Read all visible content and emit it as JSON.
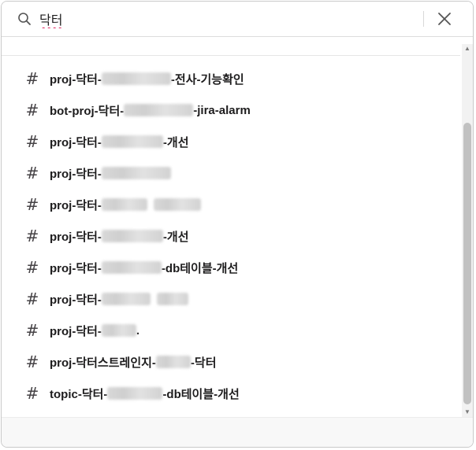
{
  "search": {
    "value": "닥터",
    "search_icon": "search-icon",
    "close_icon": "close-icon"
  },
  "results": [
    {
      "prefix": "proj-닥터-",
      "blur1": 88,
      "suffix": "-전사-기능확인"
    },
    {
      "prefix": "bot-proj-닥터-",
      "blur1": 88,
      "suffix": "-jira-alarm"
    },
    {
      "prefix": "proj-닥터-",
      "blur1": 78,
      "suffix": "-개선"
    },
    {
      "prefix": "proj-닥터-",
      "blur1": 88,
      "suffix": ""
    },
    {
      "prefix": "proj-닥터-",
      "blur1": 58,
      "blur2": 60,
      "suffix": ""
    },
    {
      "prefix": "proj-닥터-",
      "blur1": 78,
      "suffix": "-개선"
    },
    {
      "prefix": "proj-닥터-",
      "blur1": 76,
      "suffix": "-db테이블-개선"
    },
    {
      "prefix": "proj-닥터-",
      "blur1": 62,
      "blur2": 40,
      "suffix": ""
    },
    {
      "prefix": "proj-닥터-",
      "blur1": 44,
      "suffix": "."
    },
    {
      "prefix": "proj-닥터스트레인지-",
      "blur1": 44,
      "suffix": "-닥터"
    },
    {
      "prefix": "topic-닥터-",
      "blur1": 70,
      "suffix": "-db테이블-개선"
    }
  ],
  "colors": {
    "accent_underline": "#e01e5a",
    "text": "#1d1c1d"
  }
}
